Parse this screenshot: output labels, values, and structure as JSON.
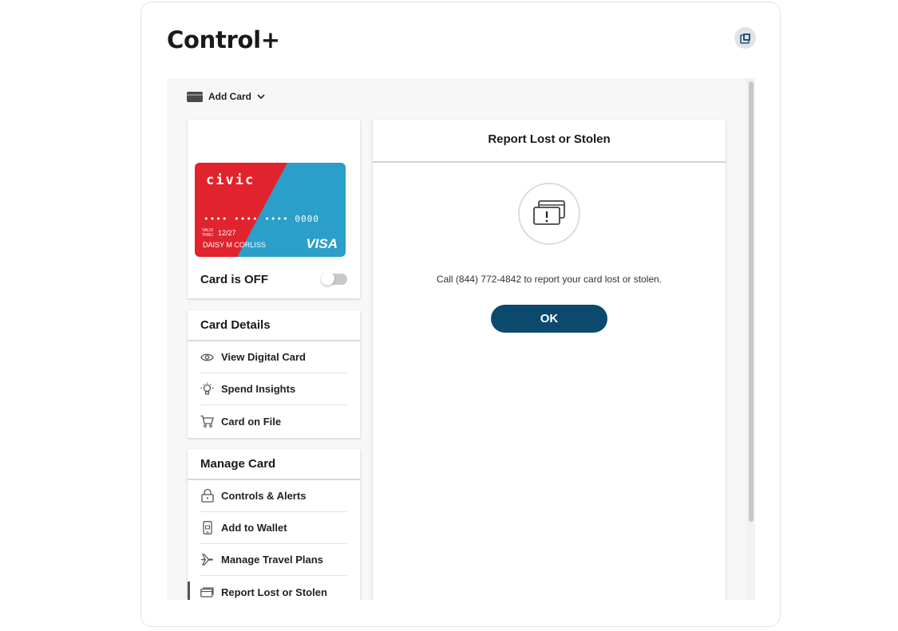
{
  "app": {
    "title": "Control+"
  },
  "toolbar": {
    "add_card_label": "Add Card",
    "add_card_icon": "card-icon",
    "dropdown_icon": "chevron-down-icon",
    "popout_icon": "popout-icon"
  },
  "card": {
    "brand": "civic",
    "number_masked": "•••• •••• •••• 0000",
    "valid_label": "VALID THRU",
    "valid_thru": "12/27",
    "holder": "DAISY M CORLISS",
    "network": "VISA",
    "status_label": "Card is OFF",
    "toggle_on": false,
    "colors": {
      "red": "#e1232e",
      "blue": "#2b9fc9"
    }
  },
  "card_details": {
    "title": "Card Details",
    "items": [
      {
        "label": "View Digital Card",
        "icon": "eye-icon"
      },
      {
        "label": "Spend Insights",
        "icon": "lightbulb-icon"
      },
      {
        "label": "Card on File",
        "icon": "cart-icon"
      }
    ]
  },
  "manage_card": {
    "title": "Manage Card",
    "items": [
      {
        "label": "Controls & Alerts",
        "icon": "lock-icon"
      },
      {
        "label": "Add to Wallet",
        "icon": "phone-icon"
      },
      {
        "label": "Manage Travel Plans",
        "icon": "airplane-icon"
      },
      {
        "label": "Report Lost or Stolen",
        "icon": "card-alert-icon",
        "active": true
      }
    ]
  },
  "report": {
    "title": "Report Lost or Stolen",
    "message": "Call (844) 772-4842 to report your card lost or stolen.",
    "ok_label": "OK",
    "icon": "card-warning-icon",
    "button_color": "#0b4a6d"
  }
}
